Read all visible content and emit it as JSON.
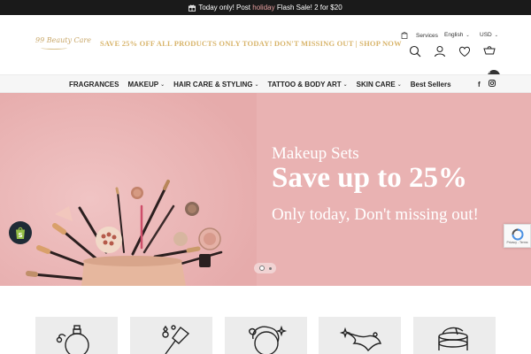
{
  "announcement": {
    "prefix": "Today only! Post ",
    "highlight": "holiday",
    "suffix": " Flash Sale! 2 for $20"
  },
  "header": {
    "logo_text": "99 Beauty Care",
    "promo": "SAVE 25% OFF ALL PRODUCTS ONLY TODAY! DON'T MISSING OUT | SHOP NOW",
    "services_label": "Services",
    "language": "English",
    "currency": "USD",
    "cart_count": "0"
  },
  "nav": {
    "items": [
      {
        "label": "FRAGRANCES",
        "dropdown": false
      },
      {
        "label": "MAKEUP",
        "dropdown": true
      },
      {
        "label": "HAIR CARE & STYLING",
        "dropdown": true
      },
      {
        "label": "TATTOO & BODY ART",
        "dropdown": true
      },
      {
        "label": "SKIN CARE",
        "dropdown": true
      },
      {
        "label": "Best Sellers",
        "dropdown": false
      }
    ],
    "facebook": "f"
  },
  "hero": {
    "subtitle": "Makeup Sets",
    "title": "Save up to 25%",
    "tagline": "Only today, Don't missing out!",
    "background": "#e9b2b2"
  },
  "recaptcha": {
    "links": "Privacy - Terms"
  },
  "categories": [
    {
      "icon": "perfume-bottle-icon"
    },
    {
      "icon": "makeup-brush-icon"
    },
    {
      "icon": "hair-woman-icon"
    },
    {
      "icon": "tattoo-swallow-icon"
    },
    {
      "icon": "skincare-jar-icon"
    }
  ],
  "colors": {
    "accent_gold": "#d8b46a",
    "topbar": "#1a1a1a",
    "hero_pink": "#e9b2b2"
  }
}
